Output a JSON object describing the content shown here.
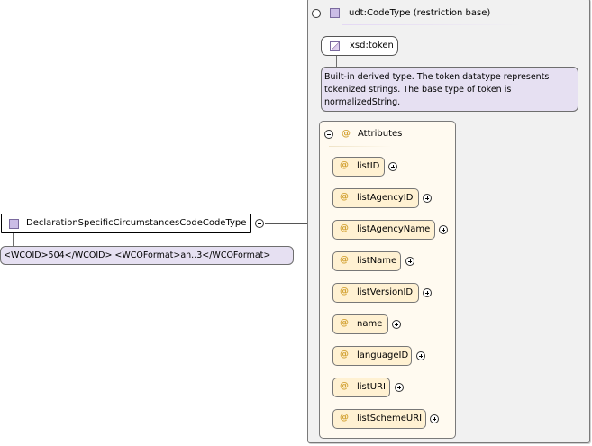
{
  "type_box": {
    "label": "DeclarationSpecificCircumstancesCodeCodeType",
    "annotation": "<WCOID>504</WCOID> <WCOFormat>an..3</WCOFormat>"
  },
  "restriction": {
    "header": "udt:CodeType (restriction base)",
    "token_label": "xsd:token",
    "token_description": [
      "Built-in derived type. The token datatype represents",
      "tokenized strings. The base type of token is",
      "normalizedString."
    ]
  },
  "attributes": {
    "title": "Attributes",
    "symbol": "@",
    "items": [
      {
        "name": "listID"
      },
      {
        "name": "listAgencyID"
      },
      {
        "name": "listAgencyName"
      },
      {
        "name": "listName"
      },
      {
        "name": "listVersionID"
      },
      {
        "name": "name"
      },
      {
        "name": "languageID"
      },
      {
        "name": "listURI"
      },
      {
        "name": "listSchemeURI"
      }
    ]
  },
  "colors": {
    "type_icon": "#cbbde6",
    "annotation_bg": "#e6e0f2",
    "attribute_bg": "#fff1d2",
    "attribute_symbol": "#d4a437",
    "container_bg": "#f1f1f1"
  }
}
